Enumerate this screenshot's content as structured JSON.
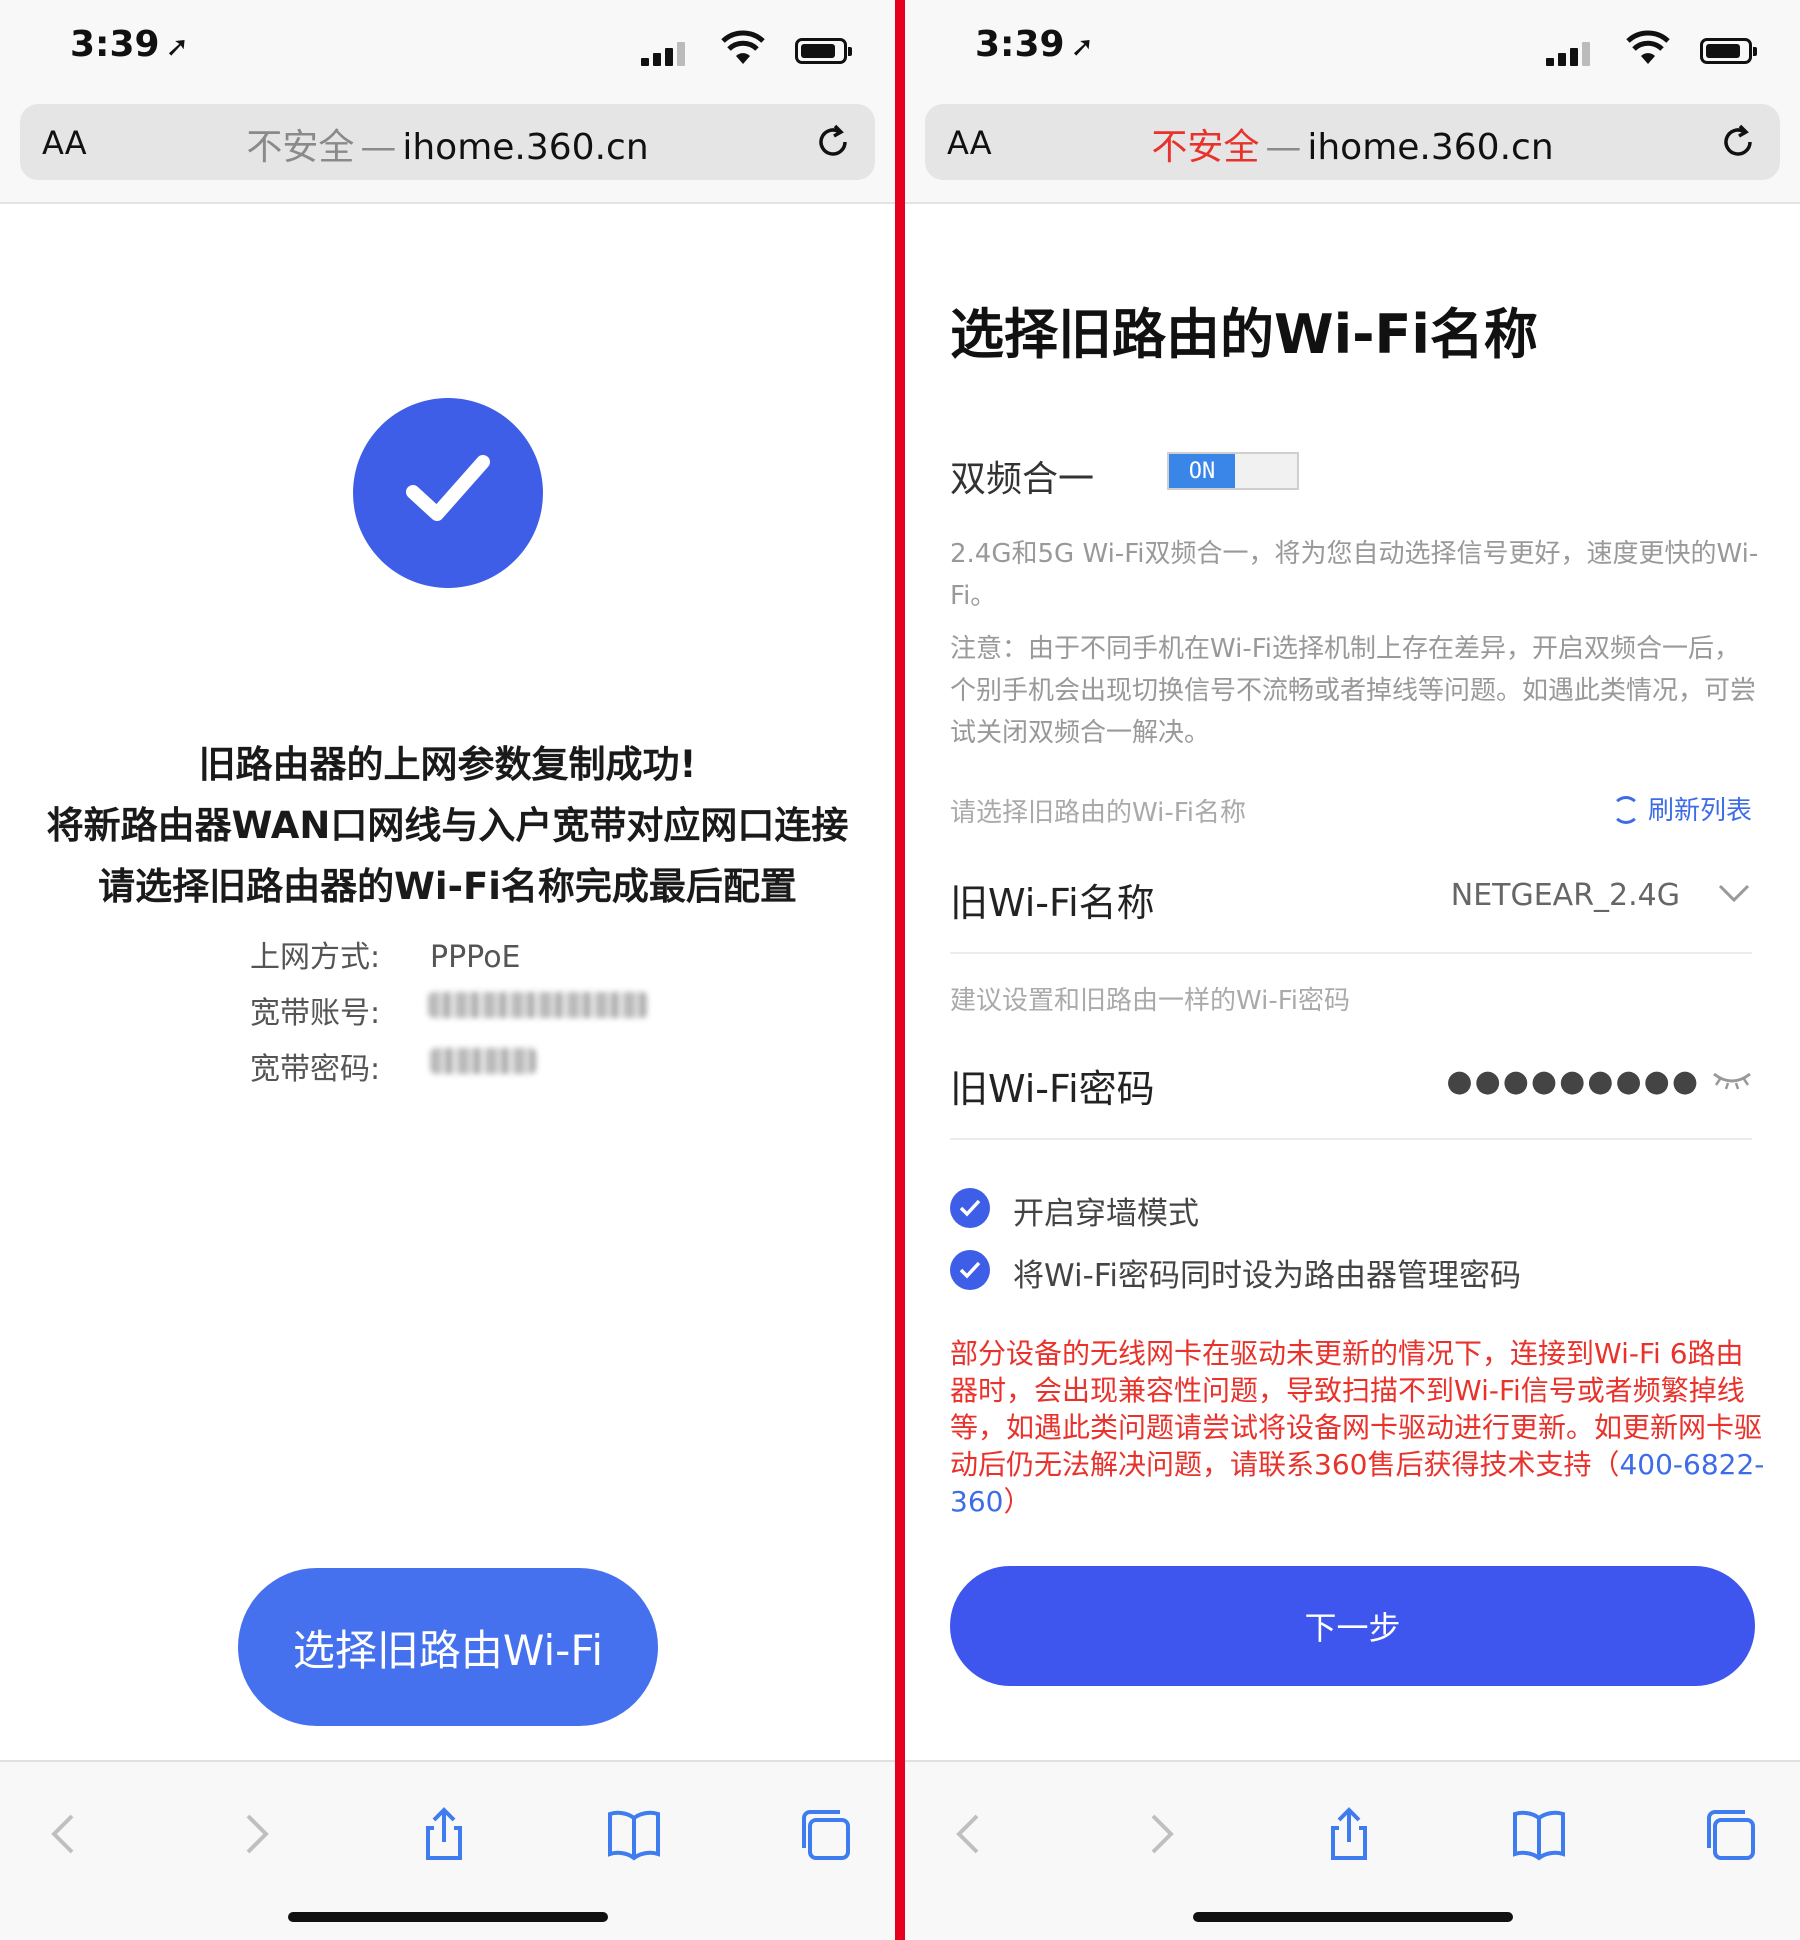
{
  "status_bar": {
    "time": "3:39",
    "location_arrow": "➚"
  },
  "browser": {
    "text_size_button": "AA",
    "insecure_label": "不安全",
    "separator": "—",
    "domain": "ihome.360.cn"
  },
  "left": {
    "success_lines": [
      "旧路由器的上网参数复制成功!",
      "将新路由器WAN口网线与入户宽带对应网口连接",
      "请选择旧路由器的Wi-Fi名称完成最后配置"
    ],
    "info": [
      {
        "label": "上网方式:",
        "value": "PPPoE"
      },
      {
        "label": "宽带账号:",
        "value": ""
      },
      {
        "label": "宽带密码:",
        "value": ""
      }
    ],
    "button_label": "选择旧路由Wi-Fi"
  },
  "right": {
    "title": "选择旧路由的Wi-Fi名称",
    "dual_band_label": "双频合一",
    "toggle_text": "ON",
    "dual_band_desc": "2.4G和5G Wi-Fi双频合一，将为您自动选择信号更好，速度更快的Wi-Fi。",
    "dual_band_note": "注意：由于不同手机在Wi-Fi选择机制上存在差异，开启双频合一后，个别手机会出现切换信号不流畅或者掉线等问题。如遇此类情况，可尝试关闭双频合一解决。",
    "select_hint": "请选择旧路由的Wi-Fi名称",
    "refresh_label": "刷新列表",
    "wifi_name_label": "旧Wi-Fi名称",
    "wifi_name_value": "NETGEAR_2.4G",
    "password_hint": "建议设置和旧路由一样的Wi-Fi密码",
    "wifi_password_label": "旧Wi-Fi密码",
    "wifi_password_masked": "●●●●●●●●●",
    "checkboxes": [
      {
        "label": "开启穿墙模式",
        "checked": true
      },
      {
        "label": "将Wi-Fi密码同时设为路由器管理密码",
        "checked": true
      }
    ],
    "warning_text": "部分设备的无线网卡在驱动未更新的情况下，连接到Wi-Fi 6路由器时，会出现兼容性问题，导致扫描不到Wi-Fi信号或者频繁掉线等，如遇此类问题请尝试将设备网卡驱动进行更新。如更新网卡驱动后仍无法解决问题，请联系360售后获得技术支持（",
    "warning_phone": "400-6822-360",
    "warning_close": "）",
    "next_label": "下一步"
  },
  "colors": {
    "accent_blue": "#3e5ee8",
    "button_blue": "#4571ee",
    "warning_red": "#e8322b",
    "divider_red": "#e6001e"
  },
  "icons": [
    "location-arrow-icon",
    "signal-icon",
    "wifi-icon",
    "battery-icon",
    "reload-icon",
    "checkmark-icon",
    "refresh-icon",
    "chevron-down-icon",
    "eye-closed-icon",
    "back-icon",
    "forward-icon",
    "share-icon",
    "bookmarks-icon",
    "tabs-icon"
  ]
}
